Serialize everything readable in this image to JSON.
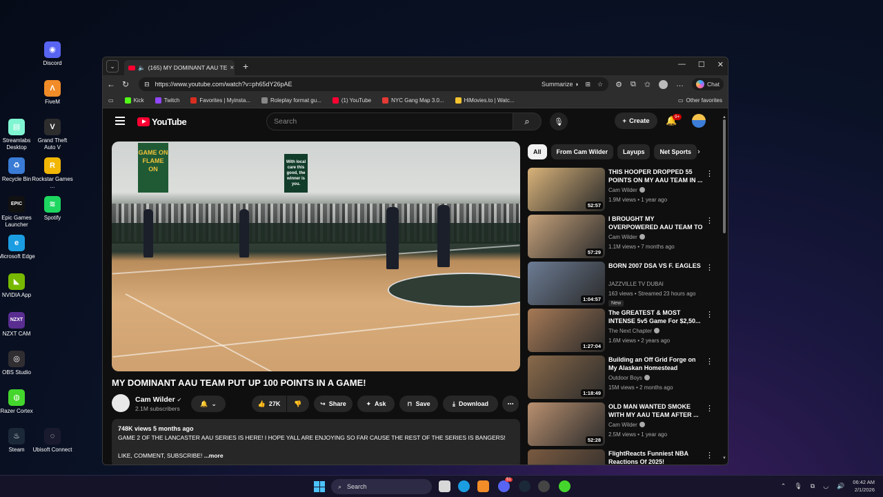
{
  "desktop": {
    "icons": [
      {
        "label": "Discord",
        "color": "#5865f2",
        "glyph": "◉"
      },
      {
        "label": "FiveM",
        "color": "#f28c28",
        "glyph": "Λ"
      },
      {
        "label": "Streamlabs Desktop",
        "color": "#80f5d2",
        "glyph": "▤"
      },
      {
        "label": "Grand Theft Auto V",
        "color": "#2d2d2d",
        "glyph": "V"
      },
      {
        "label": "Recycle Bin",
        "color": "#3a7bd5",
        "glyph": "♻"
      },
      {
        "label": "Rockstar Games ...",
        "color": "#f2b705",
        "glyph": "R"
      },
      {
        "label": "Epic Games Launcher",
        "color": "#111111",
        "glyph": "EPIC"
      },
      {
        "label": "Spotify",
        "color": "#1ed760",
        "glyph": "≋"
      },
      {
        "label": "Microsoft Edge",
        "color": "#1b9de2",
        "glyph": "e"
      },
      {
        "label": "NVIDIA App",
        "color": "#76b900",
        "glyph": "◣"
      },
      {
        "label": "NZXT CAM",
        "color": "#5a2d91",
        "glyph": "NZXT"
      },
      {
        "label": "OBS Studio",
        "color": "#302e31",
        "glyph": "◎"
      },
      {
        "label": "Razer Cortex",
        "color": "#44d62c",
        "glyph": "◍"
      },
      {
        "label": "Steam",
        "color": "#1b2838",
        "glyph": "♨"
      },
      {
        "label": "Ubisoft Connect",
        "color": "#1a1a2e",
        "glyph": "◌"
      }
    ]
  },
  "browser": {
    "tab_title": "(165) MY DOMINANT AAU TE",
    "url": "https://www.youtube.com/watch?v=ph65dY26pAE",
    "summarize_label": "Summarize",
    "chat_label": "Chat",
    "favorites": [
      {
        "label": "Kick",
        "color": "#53fc18"
      },
      {
        "label": "Twitch",
        "color": "#9146ff"
      },
      {
        "label": "Favorites | Myinsta...",
        "color": "#d92d20"
      },
      {
        "label": "Roleplay format gu...",
        "color": "#888888"
      },
      {
        "label": "(1) YouTube",
        "color": "#ff0033"
      },
      {
        "label": "NYC Gang Map 3.0...",
        "color": "#e53935"
      },
      {
        "label": "HiMovies.to | Watc...",
        "color": "#f4c430"
      }
    ],
    "other_favorites": "Other favorites"
  },
  "youtube": {
    "logo_text": "YouTube",
    "search_placeholder": "Search",
    "create_label": "Create",
    "notif_badge": "9+",
    "video": {
      "title": "MY DOMINANT AAU TEAM PUT UP 100 POINTS IN A GAME!",
      "channel": "Cam Wilder",
      "subscribers": "2.1M subscribers",
      "likes": "27K",
      "share": "Share",
      "ask": "Ask",
      "save": "Save",
      "download": "Download",
      "views_date": "748K views  5 months ago",
      "description": "GAME 2 OF THE LANCASTER AAU SERIES IS HERE! I HOPE YALL ARE ENJOYING SO FAR CAUSE THE REST OF THE SERIES IS BANGERS!",
      "description2": "LIKE, COMMENT, SUBSCRIBE!",
      "more": "...more",
      "banner1": "GAME ON FLAME ON",
      "banner2": "With local care this good, the winner is you."
    },
    "chips": [
      "All",
      "From Cam Wilder",
      "Layups",
      "Net Sports"
    ],
    "recommendations": [
      {
        "title": "THIS HOOPER DROPPED 55 POINTS ON MY AAU TEAM IN ...",
        "channel": "Cam Wilder",
        "verified": true,
        "meta": "1.9M views • 1 year ago",
        "duration": "52:57",
        "bg": "#d9b37a"
      },
      {
        "title": "I BROUGHT MY OVERPOWERED AAU TEAM TO MIAMI!",
        "channel": "Cam Wilder",
        "verified": true,
        "meta": "1.1M views • 7 months ago",
        "duration": "57:29",
        "bg": "#c6a27b"
      },
      {
        "title": "BORN 2007 DSA VS F. EAGLES",
        "channel": "JAZZVILLE TV DUBAI",
        "verified": false,
        "meta": "163 views • Streamed 23 hours ago",
        "duration": "1:04:57",
        "bg": "#6c7c94",
        "badge": "New"
      },
      {
        "title": "The GREATEST & MOST INTENSE 5v5 Game For $2,50...",
        "channel": "The Next Chapter",
        "verified": true,
        "meta": "1.6M views • 2 years ago",
        "duration": "1:27:04",
        "bg": "#a77a56"
      },
      {
        "title": "Building an Off Grid Forge on My Alaskan Homestead",
        "channel": "Outdoor Boys",
        "verified": true,
        "meta": "15M views • 2 months ago",
        "duration": "1:18:49",
        "bg": "#8a6a4a"
      },
      {
        "title": "OLD MAN WANTED SMOKE WITH MY AAU TEAM AFTER ...",
        "channel": "Cam Wilder",
        "verified": true,
        "meta": "2.5M views • 1 year ago",
        "duration": "52:28",
        "bg": "#b99070"
      },
      {
        "title": "FlightReacts Funniest NBA Reactions Of 2025!",
        "channel": "",
        "verified": false,
        "meta": "",
        "duration": "",
        "bg": "#7a5a40"
      }
    ]
  },
  "taskbar": {
    "search_label": "Search",
    "time": "06:42 AM",
    "date": "2/1/2026",
    "discord_badge": "51"
  }
}
